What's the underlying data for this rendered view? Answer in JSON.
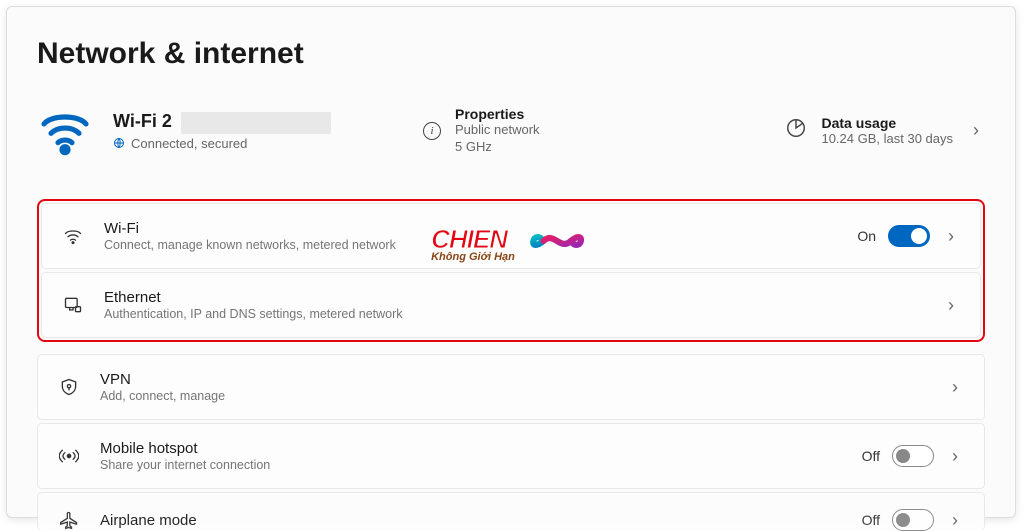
{
  "page": {
    "title": "Network & internet"
  },
  "current_connection": {
    "name": "Wi-Fi 2",
    "status": "Connected, secured"
  },
  "properties": {
    "title": "Properties",
    "line1": "Public network",
    "line2": "5 GHz"
  },
  "usage": {
    "title": "Data usage",
    "line1": "10.24 GB, last 30 days"
  },
  "items": {
    "wifi": {
      "title": "Wi-Fi",
      "desc": "Connect, manage known networks, metered network",
      "toggle_state": "On"
    },
    "ethernet": {
      "title": "Ethernet",
      "desc": "Authentication, IP and DNS settings, metered network"
    },
    "vpn": {
      "title": "VPN",
      "desc": "Add, connect, manage"
    },
    "hotspot": {
      "title": "Mobile hotspot",
      "desc": "Share your internet connection",
      "toggle_state": "Off"
    },
    "airplane": {
      "title": "Airplane mode",
      "toggle_state": "Off"
    }
  },
  "watermark": {
    "main": "CHIEN",
    "sub": "Không Giới Hạn"
  }
}
